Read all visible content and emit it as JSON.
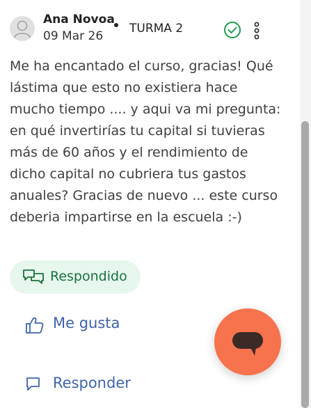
{
  "post": {
    "author": "Ana Novoa",
    "date": "09 Mar 26",
    "group": "TURMA 2",
    "body": "Me ha encantado el curso, gracias! Qué lástima que esto no existiera hace mucho tiempo .... y aqui va mi pregunta: en qué invertirías tu capital si tuvieras más de 60 años y el rendimiento de dicho capital no cubriera tus gastos anuales? Gracias de nuevo ... este curso deberia impartirse en la escuela :-)",
    "status_label": "Respondido",
    "like_label": "Me gusta",
    "reply_label": "Responder"
  },
  "icons": {
    "avatar": "user-avatar-icon",
    "answered": "check-circle-icon",
    "more": "more-vertical-icon",
    "status": "chat-bubbles-icon",
    "like": "thumbs-up-icon",
    "reply": "chat-bubble-icon",
    "fab": "chat-icon"
  },
  "colors": {
    "answered_green": "#17723b",
    "answered_bg": "#e7f7ee",
    "action_blue": "#3e63a8",
    "fab_orange": "#f7734d",
    "check_green": "#1e9a4d"
  }
}
